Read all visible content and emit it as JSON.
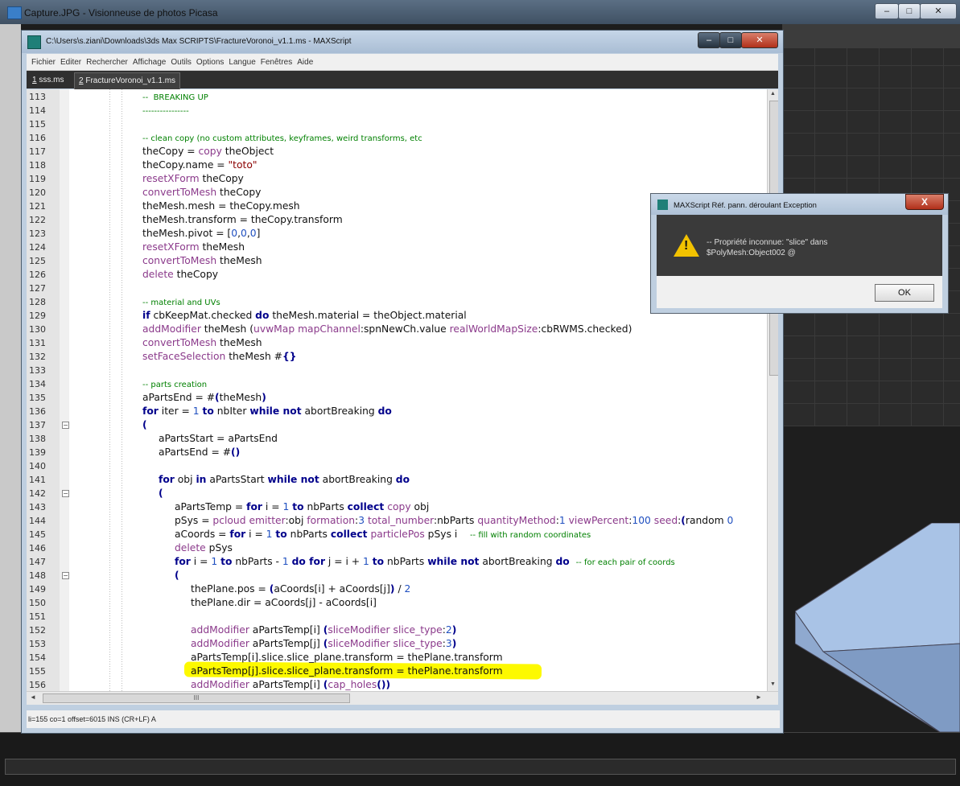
{
  "viewer": {
    "title": "Capture.JPG - Visionneuse de photos Picasa"
  },
  "editor": {
    "title": "C:\\Users\\s.ziani\\Downloads\\3ds Max SCRIPTS\\FractureVoronoi_v1.1.ms - MAXScript",
    "menu": [
      "Fichier",
      "Editer",
      "Rechercher",
      "Affichage",
      "Outils",
      "Options",
      "Langue",
      "Fenêtres",
      "Aide"
    ],
    "tabs": [
      {
        "hot": "1",
        "rest": " sss.ms"
      },
      {
        "hot": "2",
        "rest": " FractureVoronoi_v1.1.ms"
      }
    ],
    "status": "li=155 co=1 offset=6015 INS (CR+LF) A",
    "hscroll_grip": "III"
  },
  "dialog": {
    "title": "MAXScript Réf. pann. déroulant Exception",
    "message_line1": "-- Propriété inconnue: \"slice\" dans",
    "message_line2": "$PolyMesh:Object002 @",
    "ok_label": "OK",
    "close_label": "X"
  },
  "code_lines": [
    {
      "n": "113",
      "indent": 4,
      "fold": "",
      "segs": [
        [
          "c",
          "--  BREAKING UP"
        ]
      ]
    },
    {
      "n": "114",
      "indent": 4,
      "fold": "",
      "segs": [
        [
          "c",
          "----------------"
        ]
      ]
    },
    {
      "n": "115",
      "indent": 0,
      "fold": "",
      "segs": []
    },
    {
      "n": "116",
      "indent": 4,
      "fold": "",
      "segs": [
        [
          "c",
          "-- clean copy (no custom attributes, keyframes, weird transforms, etc"
        ]
      ]
    },
    {
      "n": "117",
      "indent": 4,
      "fold": "",
      "segs": [
        [
          "",
          "theCopy = "
        ],
        [
          "f",
          "copy"
        ],
        [
          "",
          " theObject"
        ]
      ]
    },
    {
      "n": "118",
      "indent": 4,
      "fold": "",
      "segs": [
        [
          "",
          "theCopy.name = "
        ],
        [
          "s",
          "\"toto\""
        ]
      ]
    },
    {
      "n": "119",
      "indent": 4,
      "fold": "",
      "segs": [
        [
          "f",
          "resetXForm"
        ],
        [
          "",
          " theCopy"
        ]
      ]
    },
    {
      "n": "120",
      "indent": 4,
      "fold": "",
      "segs": [
        [
          "f",
          "convertToMesh"
        ],
        [
          "",
          " theCopy"
        ]
      ]
    },
    {
      "n": "121",
      "indent": 4,
      "fold": "",
      "segs": [
        [
          "",
          "theMesh.mesh = theCopy.mesh"
        ]
      ]
    },
    {
      "n": "122",
      "indent": 4,
      "fold": "",
      "segs": [
        [
          "",
          "theMesh.transform = theCopy.transform"
        ]
      ]
    },
    {
      "n": "123",
      "indent": 4,
      "fold": "",
      "segs": [
        [
          "",
          "theMesh.pivot = ["
        ],
        [
          "n",
          "0"
        ],
        [
          "",
          ","
        ],
        [
          "n",
          "0"
        ],
        [
          "",
          ","
        ],
        [
          "n",
          "0"
        ],
        [
          "",
          "]"
        ]
      ]
    },
    {
      "n": "124",
      "indent": 4,
      "fold": "",
      "segs": [
        [
          "f",
          "resetXForm"
        ],
        [
          "",
          " theMesh"
        ]
      ]
    },
    {
      "n": "125",
      "indent": 4,
      "fold": "",
      "segs": [
        [
          "f",
          "convertToMesh"
        ],
        [
          "",
          " theMesh"
        ]
      ]
    },
    {
      "n": "126",
      "indent": 4,
      "fold": "",
      "segs": [
        [
          "f",
          "delete"
        ],
        [
          "",
          " theCopy"
        ]
      ]
    },
    {
      "n": "127",
      "indent": 0,
      "fold": "",
      "segs": []
    },
    {
      "n": "128",
      "indent": 4,
      "fold": "",
      "segs": [
        [
          "c",
          "-- material and UVs"
        ]
      ]
    },
    {
      "n": "129",
      "indent": 4,
      "fold": "",
      "segs": [
        [
          "k",
          "if"
        ],
        [
          "",
          " cbKeepMat.checked "
        ],
        [
          "k",
          "do"
        ],
        [
          "",
          " theMesh.material = theObject.material"
        ]
      ]
    },
    {
      "n": "130",
      "indent": 4,
      "fold": "",
      "segs": [
        [
          "f",
          "addModifier"
        ],
        [
          "",
          " theMesh ("
        ],
        [
          "f",
          "uvwMap"
        ],
        [
          "",
          " "
        ],
        [
          "f",
          "mapChannel"
        ],
        [
          "",
          ":spnNewCh.value "
        ],
        [
          "f",
          "realWorldMapSize"
        ],
        [
          "",
          ":cbRWMS.checked)"
        ]
      ]
    },
    {
      "n": "131",
      "indent": 4,
      "fold": "",
      "segs": [
        [
          "f",
          "convertToMesh"
        ],
        [
          "",
          " theMesh"
        ]
      ]
    },
    {
      "n": "132",
      "indent": 4,
      "fold": "",
      "segs": [
        [
          "f",
          "setFaceSelection"
        ],
        [
          "",
          " theMesh #"
        ],
        [
          "k",
          "{}"
        ]
      ]
    },
    {
      "n": "133",
      "indent": 0,
      "fold": "",
      "segs": []
    },
    {
      "n": "134",
      "indent": 4,
      "fold": "",
      "segs": [
        [
          "c",
          "-- parts creation"
        ]
      ]
    },
    {
      "n": "135",
      "indent": 4,
      "fold": "",
      "segs": [
        [
          "",
          "aPartsEnd = #"
        ],
        [
          "k",
          "("
        ],
        [
          "",
          "theMesh"
        ],
        [
          "k",
          ")"
        ]
      ]
    },
    {
      "n": "136",
      "indent": 4,
      "fold": "",
      "segs": [
        [
          "k",
          "for"
        ],
        [
          "",
          " iter = "
        ],
        [
          "n",
          "1"
        ],
        [
          "",
          " "
        ],
        [
          "k",
          "to"
        ],
        [
          "",
          " nbIter "
        ],
        [
          "k",
          "while not"
        ],
        [
          "",
          " abortBreaking "
        ],
        [
          "k",
          "do"
        ]
      ]
    },
    {
      "n": "137",
      "indent": 4,
      "fold": "⊟",
      "segs": [
        [
          "k",
          "("
        ]
      ]
    },
    {
      "n": "138",
      "indent": 5,
      "fold": "",
      "segs": [
        [
          "",
          "aPartsStart = aPartsEnd"
        ]
      ]
    },
    {
      "n": "139",
      "indent": 5,
      "fold": "",
      "segs": [
        [
          "",
          "aPartsEnd = #"
        ],
        [
          "k",
          "()"
        ]
      ]
    },
    {
      "n": "140",
      "indent": 0,
      "fold": "",
      "segs": []
    },
    {
      "n": "141",
      "indent": 5,
      "fold": "",
      "segs": [
        [
          "k",
          "for"
        ],
        [
          "",
          " obj "
        ],
        [
          "k",
          "in"
        ],
        [
          "",
          " aPartsStart "
        ],
        [
          "k",
          "while not"
        ],
        [
          "",
          " abortBreaking "
        ],
        [
          "k",
          "do"
        ]
      ]
    },
    {
      "n": "142",
      "indent": 5,
      "fold": "⊟",
      "segs": [
        [
          "k",
          "("
        ]
      ]
    },
    {
      "n": "143",
      "indent": 6,
      "fold": "",
      "segs": [
        [
          "",
          "aPartsTemp = "
        ],
        [
          "k",
          "for"
        ],
        [
          "",
          " i = "
        ],
        [
          "n",
          "1"
        ],
        [
          "",
          " "
        ],
        [
          "k",
          "to"
        ],
        [
          "",
          " nbParts "
        ],
        [
          "k",
          "collect"
        ],
        [
          "",
          " "
        ],
        [
          "f",
          "copy"
        ],
        [
          "",
          " obj"
        ]
      ]
    },
    {
      "n": "144",
      "indent": 6,
      "fold": "",
      "segs": [
        [
          "",
          "pSys = "
        ],
        [
          "f",
          "pcloud"
        ],
        [
          "",
          " "
        ],
        [
          "f",
          "emitter"
        ],
        [
          "",
          ":obj "
        ],
        [
          "f",
          "formation"
        ],
        [
          "",
          ":"
        ],
        [
          "n",
          "3"
        ],
        [
          "",
          " "
        ],
        [
          "f",
          "total_number"
        ],
        [
          "",
          ":nbParts "
        ],
        [
          "f",
          "quantityMethod"
        ],
        [
          "",
          ":"
        ],
        [
          "n",
          "1"
        ],
        [
          "",
          " "
        ],
        [
          "f",
          "viewPercent"
        ],
        [
          "",
          ":"
        ],
        [
          "n",
          "100"
        ],
        [
          "",
          " "
        ],
        [
          "f",
          "seed"
        ],
        [
          "",
          ":"
        ],
        [
          "k",
          "("
        ],
        [
          "",
          "random "
        ],
        [
          "n",
          "0"
        ]
      ]
    },
    {
      "n": "145",
      "indent": 6,
      "fold": "",
      "segs": [
        [
          "",
          "aCoords = "
        ],
        [
          "k",
          "for"
        ],
        [
          "",
          " i = "
        ],
        [
          "n",
          "1"
        ],
        [
          "",
          " "
        ],
        [
          "k",
          "to"
        ],
        [
          "",
          " nbParts "
        ],
        [
          "k",
          "collect"
        ],
        [
          "",
          " "
        ],
        [
          "f",
          "particlePos"
        ],
        [
          "",
          " pSys i    "
        ],
        [
          "c",
          "-- fill with random coordinates"
        ]
      ]
    },
    {
      "n": "146",
      "indent": 6,
      "fold": "",
      "segs": [
        [
          "f",
          "delete"
        ],
        [
          "",
          " pSys"
        ]
      ]
    },
    {
      "n": "147",
      "indent": 6,
      "fold": "",
      "segs": [
        [
          "k",
          "for"
        ],
        [
          "",
          " i = "
        ],
        [
          "n",
          "1"
        ],
        [
          "",
          " "
        ],
        [
          "k",
          "to"
        ],
        [
          "",
          " nbParts - "
        ],
        [
          "n",
          "1"
        ],
        [
          "",
          " "
        ],
        [
          "k",
          "do for"
        ],
        [
          "",
          " j = i + "
        ],
        [
          "n",
          "1"
        ],
        [
          "",
          " "
        ],
        [
          "k",
          "to"
        ],
        [
          "",
          " nbParts "
        ],
        [
          "k",
          "while not"
        ],
        [
          "",
          " abortBreaking "
        ],
        [
          "k",
          "do"
        ],
        [
          "",
          "  "
        ],
        [
          "c",
          "-- for each pair of coords"
        ]
      ]
    },
    {
      "n": "148",
      "indent": 6,
      "fold": "⊟",
      "segs": [
        [
          "k",
          "("
        ]
      ]
    },
    {
      "n": "149",
      "indent": 7,
      "fold": "",
      "segs": [
        [
          "",
          "thePlane.pos = "
        ],
        [
          "k",
          "("
        ],
        [
          "",
          "aCoords[i] + aCoords[j]"
        ],
        [
          "k",
          ")"
        ],
        [
          "",
          " / "
        ],
        [
          "n",
          "2"
        ]
      ]
    },
    {
      "n": "150",
      "indent": 7,
      "fold": "",
      "segs": [
        [
          "",
          "thePlane.dir = aCoords[j] - aCoords[i]"
        ]
      ]
    },
    {
      "n": "151",
      "indent": 0,
      "fold": "",
      "segs": []
    },
    {
      "n": "152",
      "indent": 7,
      "fold": "",
      "segs": [
        [
          "f",
          "addModifier"
        ],
        [
          "",
          " aPartsTemp[i] "
        ],
        [
          "k",
          "("
        ],
        [
          "f",
          "sliceModifier"
        ],
        [
          "",
          " "
        ],
        [
          "f",
          "slice_type"
        ],
        [
          "",
          ":"
        ],
        [
          "n",
          "2"
        ],
        [
          "k",
          ")"
        ]
      ]
    },
    {
      "n": "153",
      "indent": 7,
      "fold": "",
      "segs": [
        [
          "f",
          "addModifier"
        ],
        [
          "",
          " aPartsTemp[j] "
        ],
        [
          "k",
          "("
        ],
        [
          "f",
          "sliceModifier"
        ],
        [
          "",
          " "
        ],
        [
          "f",
          "slice_type"
        ],
        [
          "",
          ":"
        ],
        [
          "n",
          "3"
        ],
        [
          "k",
          ")"
        ]
      ]
    },
    {
      "n": "154",
      "indent": 7,
      "fold": "",
      "segs": [
        [
          "",
          "aPartsTemp[i].slice.slice_plane.transform = thePlane.transform"
        ]
      ]
    },
    {
      "n": "155",
      "indent": 7,
      "fold": "",
      "segs": [
        [
          "",
          "aPartsTemp[j].slice.slice_plane.transform = thePlane.transform"
        ]
      ]
    },
    {
      "n": "156",
      "indent": 7,
      "fold": "",
      "segs": [
        [
          "f",
          "addModifier"
        ],
        [
          "",
          " aPartsTemp[i] "
        ],
        [
          "k",
          "("
        ],
        [
          "f",
          "cap_holes"
        ],
        [
          "k",
          "()"
        ],
        [
          "k",
          ")"
        ]
      ]
    }
  ]
}
